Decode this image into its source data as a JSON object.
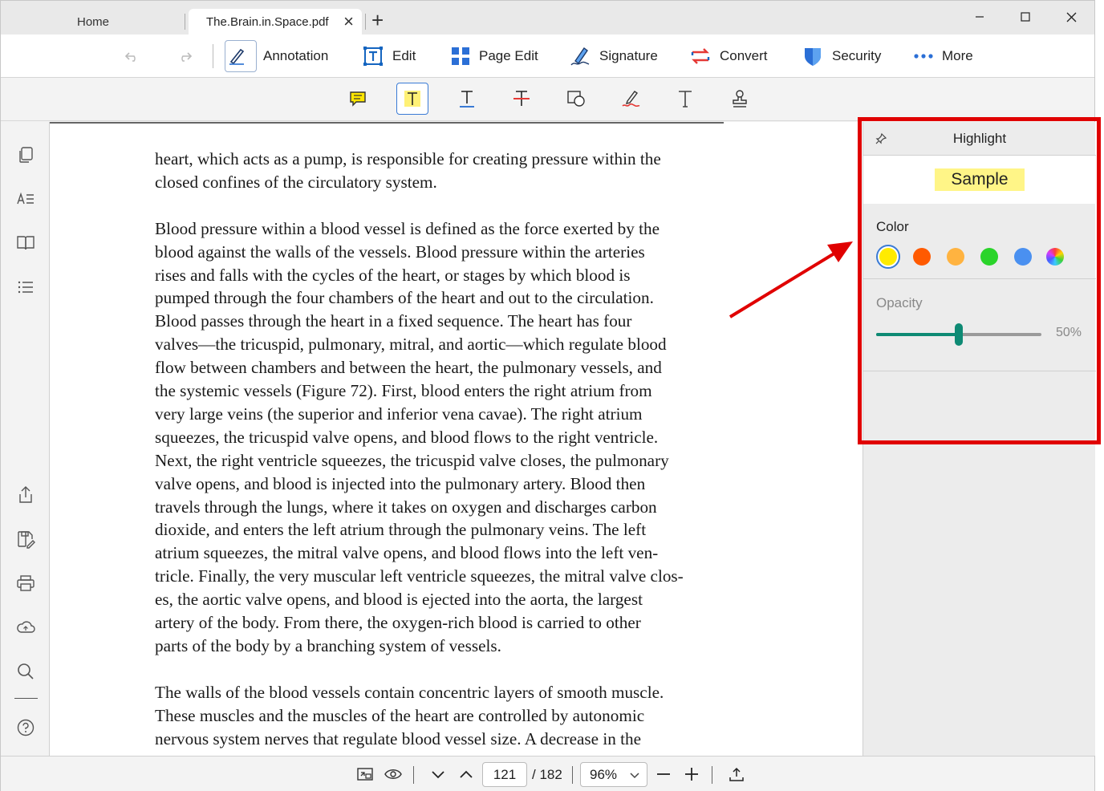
{
  "tabs": {
    "home": "Home",
    "document": "The.Brain.in.Space.pdf"
  },
  "toolbar": {
    "annotation": "Annotation",
    "edit": "Edit",
    "page_edit": "Page Edit",
    "signature": "Signature",
    "convert": "Convert",
    "security": "Security",
    "more": "More"
  },
  "document": {
    "paragraphs": [
      "heart, which acts as a pump, is responsible for creating pressure within the\nclosed confines of the circulatory system.",
      "Blood pressure within a blood vessel is defined as the force exerted by the\nblood against the walls of the vessels. Blood pressure within the arteries\nrises and falls with the cycles of the heart, or stages by which blood is\npumped through the four chambers of the heart and out to the circulation.\nBlood passes through the heart in a fixed sequence. The heart has four\nvalves—the tricuspid, pulmonary, mitral, and aortic—which regulate blood\nflow between chambers and between the heart, the pulmonary vessels, and\nthe systemic vessels (Figure 72). First, blood enters the right atrium from\nvery large veins (the superior and inferior vena cavae). The right atrium\nsqueezes, the tricuspid valve opens, and blood flows to the right ventricle.\nNext, the right ventricle squeezes, the tricuspid valve closes, the pulmonary\nvalve opens, and blood is injected into the pulmonary artery. Blood then\ntravels through the lungs, where it takes on oxygen and discharges carbon\ndioxide, and enters the left atrium through the pulmonary veins. The left\natrium squeezes, the mitral valve opens, and blood flows into the left ven-\ntricle. Finally, the very muscular left ventricle squeezes, the mitral valve clos-\nes, the aortic valve opens, and blood is ejected into the aorta, the largest\nartery of the body. From there, the oxygen-rich blood is carried to other\nparts of the body by a branching system of vessels.",
      "The walls of the blood vessels contain concentric layers of smooth muscle.\nThese muscles and the muscles of the heart are controlled by autonomic\nnervous system nerves that regulate blood vessel size. A decrease in the"
    ]
  },
  "highlight_panel": {
    "title": "Highlight",
    "sample": "Sample",
    "color_label": "Color",
    "colors": [
      "#ffeb00",
      "#ff5a00",
      "#ffb340",
      "#2ad42a",
      "#4a90f0",
      "rainbow"
    ],
    "selected_color": "#ffeb00",
    "opacity_label": "Opacity",
    "opacity_percent": 50,
    "opacity_text": "50%"
  },
  "bottom_bar": {
    "current_page": "121",
    "total_pages": "/ 182",
    "zoom": "96%"
  },
  "icons": {
    "undo": "undo-icon",
    "redo": "redo-icon",
    "annotation": "pen-icon",
    "edit": "text-box-icon",
    "page_edit": "grid-icon",
    "signature": "signature-pen-icon",
    "convert": "convert-arrows-icon",
    "security": "shield-icon",
    "more": "dots-icon"
  }
}
